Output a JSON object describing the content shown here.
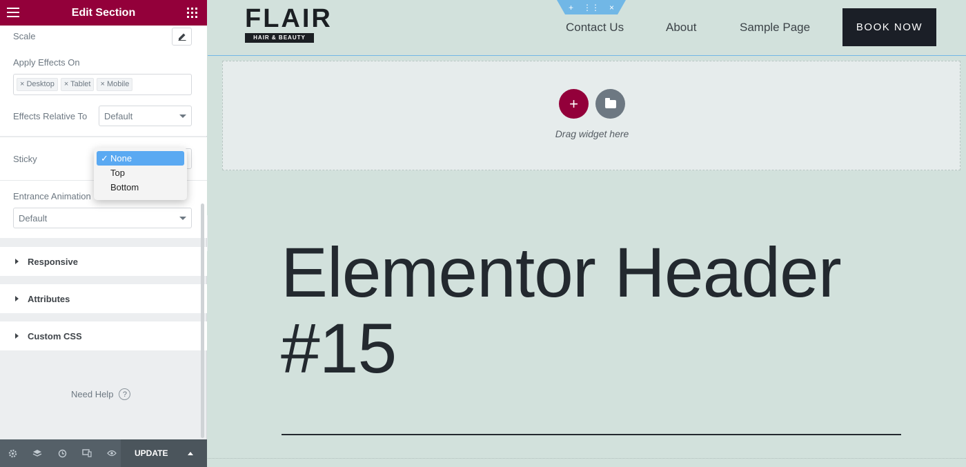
{
  "panel": {
    "title": "Edit Section",
    "scale_label": "Scale",
    "apply_effects_label": "Apply Effects On",
    "apply_effects_tags": [
      "Desktop",
      "Tablet",
      "Mobile"
    ],
    "effects_relative_label": "Effects Relative To",
    "effects_relative_value": "Default",
    "sticky_label": "Sticky",
    "sticky_options": [
      {
        "label": "None",
        "selected": true
      },
      {
        "label": "Top",
        "selected": false
      },
      {
        "label": "Bottom",
        "selected": false
      }
    ],
    "entrance_label": "Entrance Animation",
    "entrance_value": "Default",
    "accordions": [
      "Responsive",
      "Attributes",
      "Custom CSS"
    ],
    "need_help": "Need Help",
    "help_mark": "?",
    "update_label": "UPDATE",
    "accent_color": "#93003a"
  },
  "preview": {
    "logo_big": "FLAIR",
    "logo_small": "HAIR & BEAUTY",
    "nav": [
      "Contact Us",
      "About",
      "Sample Page"
    ],
    "cta": "BOOK NOW",
    "handle_icons": [
      "+",
      "⋮⋮",
      "×"
    ],
    "drag_text": "Drag widget here",
    "add_symbol": "+",
    "hero_line1": "Elementor Header",
    "hero_line2": "#15"
  }
}
